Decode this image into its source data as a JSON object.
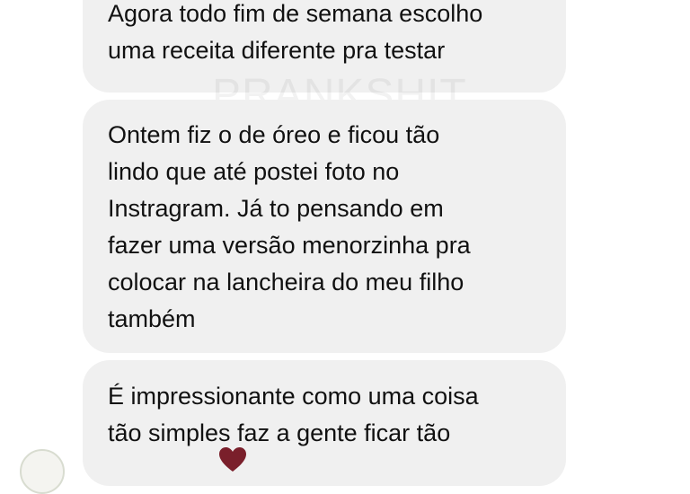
{
  "watermark": "PRANKSHIT",
  "messages": [
    {
      "lines": [
        "Agora todo fim de semana escolho",
        "uma receita diferente pra testar"
      ]
    },
    {
      "lines": [
        "Ontem fiz o de óreo e ficou tão",
        "lindo que até postei foto no",
        "Instragram. Já to pensando em",
        "fazer uma versão menorzinha pra",
        "colocar na lancheira do meu filho",
        "também"
      ]
    },
    {
      "lines": [
        "É impressionante como uma coisa",
        "tão simples faz a gente ficar tão"
      ]
    }
  ],
  "colors": {
    "bubble": "#f0f0f0",
    "text": "#111111",
    "heart": "#7a1f2b"
  },
  "icons": [
    "heart-icon"
  ]
}
